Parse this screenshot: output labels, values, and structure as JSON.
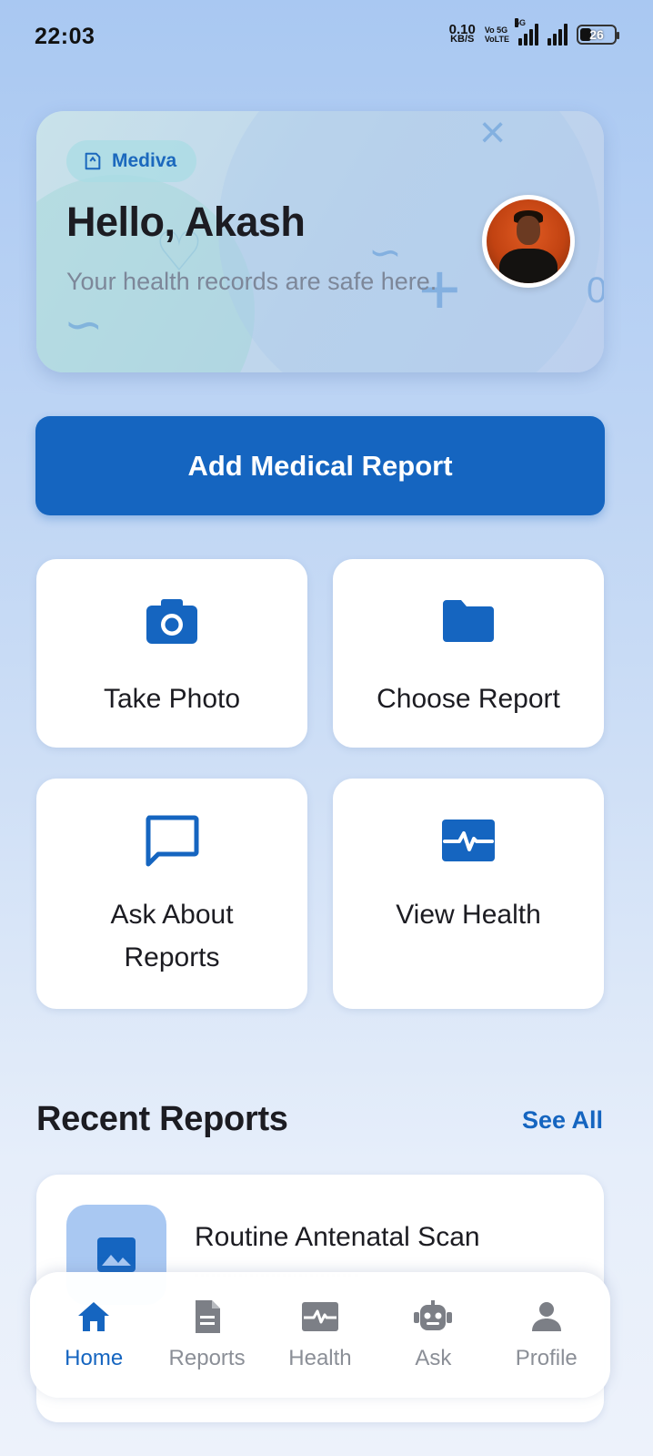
{
  "status_bar": {
    "time": "22:03",
    "speed_value": "0.10",
    "speed_unit": "KB/S",
    "volte1": "Vo 5G",
    "volte2": "VoLTE",
    "net_tag": "5G",
    "battery": "26"
  },
  "hero": {
    "brand": "Mediva",
    "greeting": "Hello, Akash",
    "subtitle": "Your health records are safe here."
  },
  "actions": {
    "add_report": "Add Medical Report",
    "tiles": [
      {
        "label": "Take Photo",
        "icon": "camera-icon"
      },
      {
        "label": "Choose Report",
        "icon": "folder-icon"
      },
      {
        "label": "Ask About Reports",
        "icon": "chat-bubble-icon"
      },
      {
        "label": "View Health",
        "icon": "heartbeat-icon"
      }
    ]
  },
  "recent": {
    "title": "Recent Reports",
    "see_all": "See All",
    "items": [
      {
        "title": "Routine Antenatal Scan",
        "icon": "image-icon"
      }
    ]
  },
  "nav": {
    "items": [
      {
        "label": "Home",
        "icon": "home-icon",
        "active": true
      },
      {
        "label": "Reports",
        "icon": "document-icon",
        "active": false
      },
      {
        "label": "Health",
        "icon": "heartbeat-icon",
        "active": false
      },
      {
        "label": "Ask",
        "icon": "robot-icon",
        "active": false
      },
      {
        "label": "Profile",
        "icon": "person-icon",
        "active": false
      }
    ]
  },
  "colors": {
    "primary": "#1565c0",
    "inactive": "#8b8f97",
    "background_top": "#a9c8f2"
  }
}
